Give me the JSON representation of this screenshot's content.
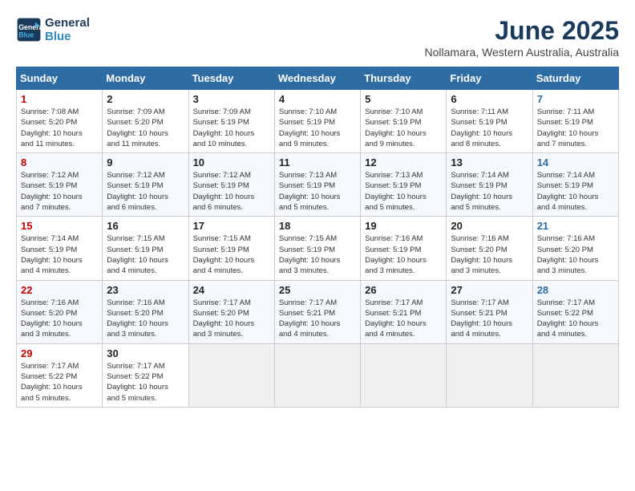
{
  "header": {
    "logo_line1": "General",
    "logo_line2": "Blue",
    "month": "June 2025",
    "location": "Nollamara, Western Australia, Australia"
  },
  "days_of_week": [
    "Sunday",
    "Monday",
    "Tuesday",
    "Wednesday",
    "Thursday",
    "Friday",
    "Saturday"
  ],
  "weeks": [
    [
      {
        "day": "1",
        "info": "Sunrise: 7:08 AM\nSunset: 5:20 PM\nDaylight: 10 hours\nand 11 minutes."
      },
      {
        "day": "2",
        "info": "Sunrise: 7:09 AM\nSunset: 5:20 PM\nDaylight: 10 hours\nand 11 minutes."
      },
      {
        "day": "3",
        "info": "Sunrise: 7:09 AM\nSunset: 5:19 PM\nDaylight: 10 hours\nand 10 minutes."
      },
      {
        "day": "4",
        "info": "Sunrise: 7:10 AM\nSunset: 5:19 PM\nDaylight: 10 hours\nand 9 minutes."
      },
      {
        "day": "5",
        "info": "Sunrise: 7:10 AM\nSunset: 5:19 PM\nDaylight: 10 hours\nand 9 minutes."
      },
      {
        "day": "6",
        "info": "Sunrise: 7:11 AM\nSunset: 5:19 PM\nDaylight: 10 hours\nand 8 minutes."
      },
      {
        "day": "7",
        "info": "Sunrise: 7:11 AM\nSunset: 5:19 PM\nDaylight: 10 hours\nand 7 minutes."
      }
    ],
    [
      {
        "day": "8",
        "info": "Sunrise: 7:12 AM\nSunset: 5:19 PM\nDaylight: 10 hours\nand 7 minutes."
      },
      {
        "day": "9",
        "info": "Sunrise: 7:12 AM\nSunset: 5:19 PM\nDaylight: 10 hours\nand 6 minutes."
      },
      {
        "day": "10",
        "info": "Sunrise: 7:12 AM\nSunset: 5:19 PM\nDaylight: 10 hours\nand 6 minutes."
      },
      {
        "day": "11",
        "info": "Sunrise: 7:13 AM\nSunset: 5:19 PM\nDaylight: 10 hours\nand 5 minutes."
      },
      {
        "day": "12",
        "info": "Sunrise: 7:13 AM\nSunset: 5:19 PM\nDaylight: 10 hours\nand 5 minutes."
      },
      {
        "day": "13",
        "info": "Sunrise: 7:14 AM\nSunset: 5:19 PM\nDaylight: 10 hours\nand 5 minutes."
      },
      {
        "day": "14",
        "info": "Sunrise: 7:14 AM\nSunset: 5:19 PM\nDaylight: 10 hours\nand 4 minutes."
      }
    ],
    [
      {
        "day": "15",
        "info": "Sunrise: 7:14 AM\nSunset: 5:19 PM\nDaylight: 10 hours\nand 4 minutes."
      },
      {
        "day": "16",
        "info": "Sunrise: 7:15 AM\nSunset: 5:19 PM\nDaylight: 10 hours\nand 4 minutes."
      },
      {
        "day": "17",
        "info": "Sunrise: 7:15 AM\nSunset: 5:19 PM\nDaylight: 10 hours\nand 4 minutes."
      },
      {
        "day": "18",
        "info": "Sunrise: 7:15 AM\nSunset: 5:19 PM\nDaylight: 10 hours\nand 3 minutes."
      },
      {
        "day": "19",
        "info": "Sunrise: 7:16 AM\nSunset: 5:19 PM\nDaylight: 10 hours\nand 3 minutes."
      },
      {
        "day": "20",
        "info": "Sunrise: 7:16 AM\nSunset: 5:20 PM\nDaylight: 10 hours\nand 3 minutes."
      },
      {
        "day": "21",
        "info": "Sunrise: 7:16 AM\nSunset: 5:20 PM\nDaylight: 10 hours\nand 3 minutes."
      }
    ],
    [
      {
        "day": "22",
        "info": "Sunrise: 7:16 AM\nSunset: 5:20 PM\nDaylight: 10 hours\nand 3 minutes."
      },
      {
        "day": "23",
        "info": "Sunrise: 7:16 AM\nSunset: 5:20 PM\nDaylight: 10 hours\nand 3 minutes."
      },
      {
        "day": "24",
        "info": "Sunrise: 7:17 AM\nSunset: 5:20 PM\nDaylight: 10 hours\nand 3 minutes."
      },
      {
        "day": "25",
        "info": "Sunrise: 7:17 AM\nSunset: 5:21 PM\nDaylight: 10 hours\nand 4 minutes."
      },
      {
        "day": "26",
        "info": "Sunrise: 7:17 AM\nSunset: 5:21 PM\nDaylight: 10 hours\nand 4 minutes."
      },
      {
        "day": "27",
        "info": "Sunrise: 7:17 AM\nSunset: 5:21 PM\nDaylight: 10 hours\nand 4 minutes."
      },
      {
        "day": "28",
        "info": "Sunrise: 7:17 AM\nSunset: 5:22 PM\nDaylight: 10 hours\nand 4 minutes."
      }
    ],
    [
      {
        "day": "29",
        "info": "Sunrise: 7:17 AM\nSunset: 5:22 PM\nDaylight: 10 hours\nand 5 minutes."
      },
      {
        "day": "30",
        "info": "Sunrise: 7:17 AM\nSunset: 5:22 PM\nDaylight: 10 hours\nand 5 minutes."
      },
      {
        "day": "",
        "info": ""
      },
      {
        "day": "",
        "info": ""
      },
      {
        "day": "",
        "info": ""
      },
      {
        "day": "",
        "info": ""
      },
      {
        "day": "",
        "info": ""
      }
    ]
  ]
}
